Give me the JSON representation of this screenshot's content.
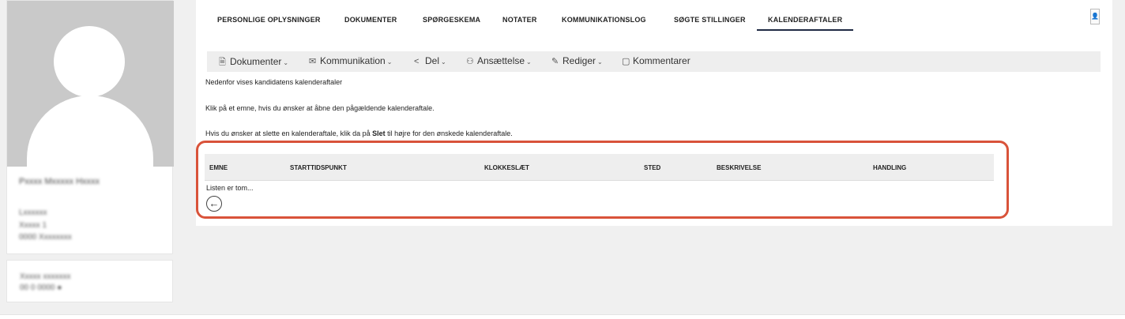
{
  "profile": {
    "avatar_icon": "user-placeholder-icon",
    "name": "Pxxxx Mxxxxx Hxxxx",
    "line1": "Lxxxxxx",
    "line2": "Xxxxx 1",
    "line3": "0000 Xxxxxxxx",
    "info_line1": "Xxxxx xxxxxxx",
    "info_line2": "00 0 0000 ●"
  },
  "tabs": [
    {
      "label": "PERSONLIGE OPLYSNINGER",
      "active": false
    },
    {
      "label": "DOKUMENTER",
      "active": false
    },
    {
      "label": "SPØRGESKEMA",
      "active": false
    },
    {
      "label": "NOTATER",
      "active": false
    },
    {
      "label": "KOMMUNIKATIONSLOG",
      "active": false
    },
    {
      "label": "SØGTE STILLINGER",
      "active": false
    },
    {
      "label": "KALENDERAFTALER",
      "active": true
    }
  ],
  "corner_button": {
    "icon": "person-icon",
    "glyph": "👤"
  },
  "toolbar": {
    "items": [
      {
        "label": "Dokumenter",
        "icon": "document-icon",
        "glyph": "🗎",
        "dropdown": true
      },
      {
        "label": "Kommunikation",
        "icon": "envelope-icon",
        "glyph": "✉",
        "dropdown": true
      },
      {
        "label": "Del",
        "icon": "share-icon",
        "glyph": "<",
        "dropdown": true
      },
      {
        "label": "Ansættelse",
        "icon": "user-check-icon",
        "glyph": "⚇",
        "dropdown": true
      },
      {
        "label": "Rediger",
        "icon": "edit-icon",
        "glyph": "✎",
        "dropdown": true
      },
      {
        "label": "Kommentarer",
        "icon": "comment-icon",
        "glyph": "▢",
        "dropdown": false
      }
    ],
    "chevron": "⌄"
  },
  "content": {
    "intro": "Nedenfor vises kandidatens kalenderaftaler",
    "instruction_open": "Klik på et emne, hvis du ønsker at åbne den pågældende kalenderaftale.",
    "instruction_delete_pre": "Hvis du ønsker at slette en kalenderaftale, klik da på ",
    "instruction_delete_bold": "Slet",
    "instruction_delete_post": " til højre for den ønskede kalenderaftale."
  },
  "table": {
    "columns": [
      "EMNE",
      "STARTTIDSPUNKT",
      "KLOKKESLÆT",
      "STED",
      "BESKRIVELSE",
      "HANDLING"
    ],
    "rows": [],
    "empty_text": "Listen er tom..."
  },
  "back_button": {
    "icon": "arrow-left-circle-icon",
    "glyph": "←"
  },
  "colors": {
    "highlight": "#d9533a",
    "active_tab_underline": "#1f2a44",
    "toolbar_bg": "#eeeeee"
  }
}
